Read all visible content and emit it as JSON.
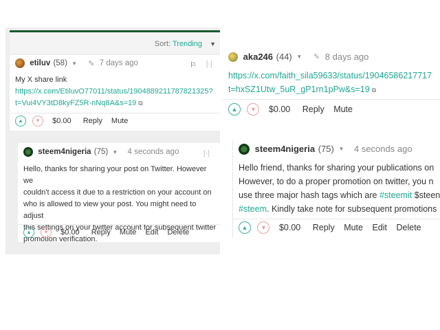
{
  "left": {
    "sort": {
      "label": "Sort:",
      "value": "Trending"
    },
    "comment1": {
      "author": "etiluv",
      "reputation": "(58)",
      "time": "7 days ago",
      "collapse": "[-]",
      "text": "My X share link",
      "link_line1": "https://x.com/EtiluvO77011/status/1904889211787821325?",
      "link_line2": "t=Vui4VY3tD8kyFZ5R-nNq8A&s=19",
      "payout": "$0.00",
      "actions": [
        "Reply",
        "Mute"
      ]
    },
    "comment2": {
      "author": "steem4nigeria",
      "reputation": "(75)",
      "time": "4 seconds ago",
      "collapse": "[-]",
      "lines": [
        "Hello, thanks for sharing your post on Twitter. However we",
        "couldn't access it due to a restriction on your account on",
        "who is allowed to view your post. You might need to adjust",
        "this settings on your twitter account for subsequent twitter",
        "promotion verification."
      ],
      "payout": "$0.00",
      "actions": [
        "Reply",
        "Mute",
        "Edit",
        "Delete"
      ]
    }
  },
  "right": {
    "comment1": {
      "author": "aka246",
      "reputation": "(44)",
      "time": "8 days ago",
      "link_line1": "https://x.com/faith_sila59633/status/19046586217717",
      "link_line2": "t=hxSZ1Utw_5uR_gP1rn1pPw&s=19",
      "payout": "$0.00",
      "actions": [
        "Reply",
        "Mute"
      ]
    },
    "comment2": {
      "author": "steem4nigeria",
      "reputation": "(75)",
      "time": "4 seconds ago",
      "line1": "Hello friend, thanks for sharing your publications on",
      "line2": "However, to do a proper promotion on twitter, you n",
      "line3_pre": "use three major hash tags which are ",
      "tag1": "#steemit",
      "line3_post": " $steen",
      "tag2": "#steem",
      "line4_post": ". Kindly take note for subsequent promotions",
      "payout": "$0.00",
      "actions": [
        "Reply",
        "Mute",
        "Edit",
        "Delete"
      ]
    }
  }
}
